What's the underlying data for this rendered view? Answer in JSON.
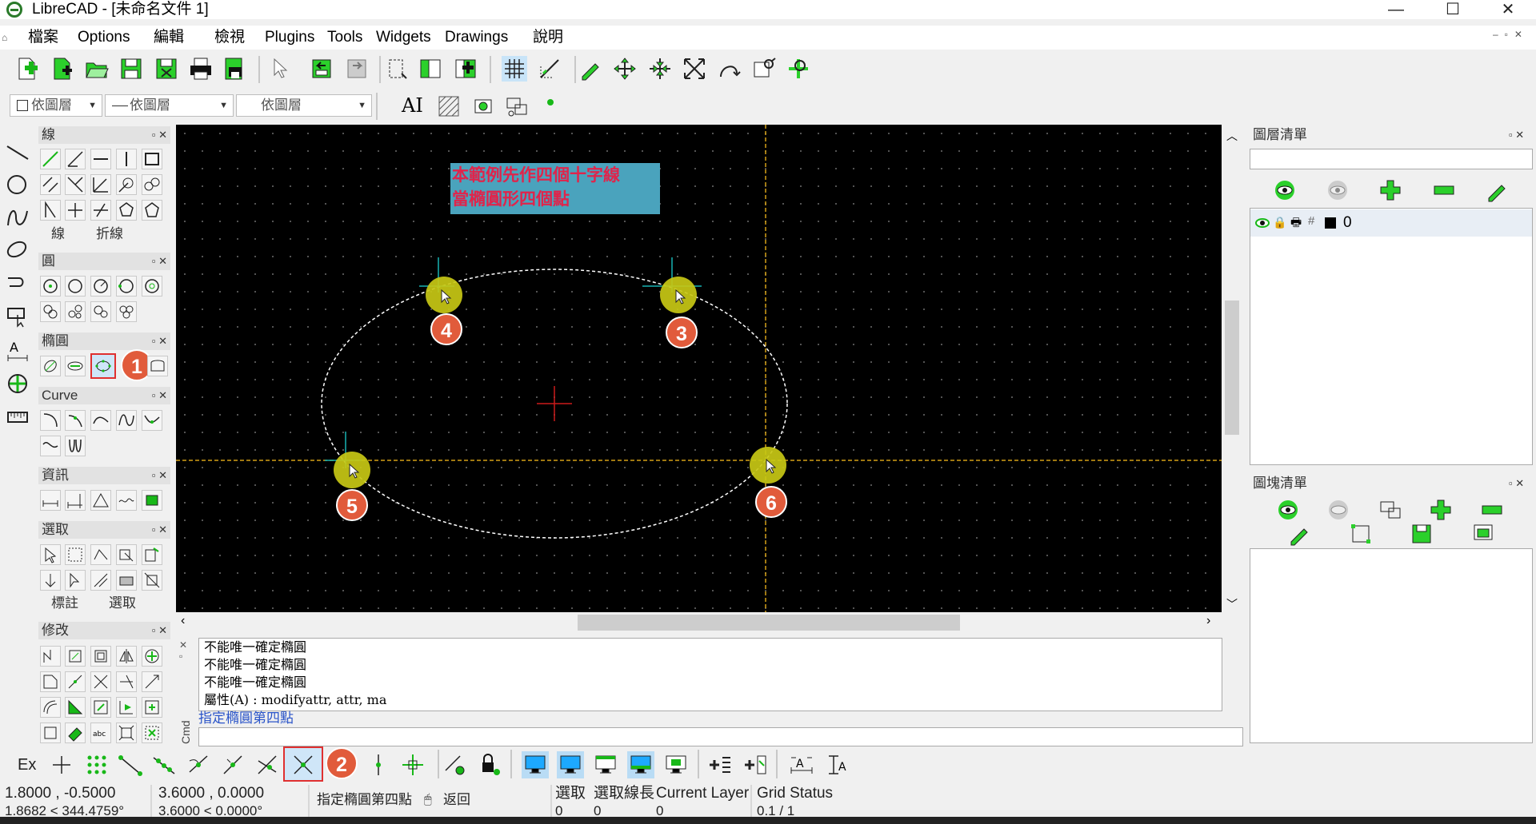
{
  "window": {
    "title": "LibreCAD - [未命名文件 1]",
    "minimize": "—",
    "maximize": "☐",
    "close": "✕"
  },
  "menu": [
    "檔案",
    "Options",
    "編輯",
    "檢視",
    "Plugins",
    "Tools",
    "Widgets",
    "Drawings",
    "說明"
  ],
  "pen_toolbar": {
    "color_combo": "依圖層",
    "linetype_combo": "依圖層",
    "linewidth_combo": "依圖層",
    "text_tool": "AI"
  },
  "left_dock": {
    "line_panel": {
      "title": "線",
      "tabs": [
        "線",
        "折線"
      ]
    },
    "circle_panel": {
      "title": "圓"
    },
    "ellipse_panel": {
      "title": "橢圓"
    },
    "curve_panel": {
      "title": "Curve"
    },
    "info_panel": {
      "title": "資訊"
    },
    "select_panel": {
      "title": "選取",
      "tabs": [
        "標註",
        "選取"
      ]
    },
    "modify_panel": {
      "title": "修改"
    }
  },
  "canvas": {
    "note_line1": "本範例先作四個十字線",
    "note_line2": "當橢圓形四個點",
    "badges": [
      "4",
      "3",
      "5",
      "6"
    ]
  },
  "step_badges": {
    "ellipse_tool": "1",
    "snap_intersection": "2"
  },
  "layer_list": {
    "title": "圖層清單",
    "filter_placeholder": "",
    "layers": [
      {
        "name": "0",
        "color": "#000000"
      }
    ]
  },
  "block_list": {
    "title": "圖塊清單"
  },
  "command": {
    "history": [
      "不能唯一確定橢圓",
      "不能唯一確定橢圓",
      "不能唯一確定橢圓",
      "屬性(A) : modifyattr, attr, ma"
    ],
    "prompt": "指定橢圓第四點",
    "side_label": "Cmd"
  },
  "status": {
    "snap_ex_label": "Ex",
    "abs_coord": "1.8000 , -0.5000",
    "abs_polar": "1.8682 < 344.4759°",
    "rel_coord": "3.6000 , 0.0000",
    "rel_polar": "3.6000 < 0.0000°",
    "action_prompt": "指定橢圓第四點",
    "back_label": "返回",
    "selected_label": "選取",
    "selected_value": "0",
    "sel_length_label": "選取線長",
    "sel_length_value": "0",
    "current_layer_label": "Current Layer",
    "current_layer_value": "0",
    "grid_status_label": "Grid Status",
    "grid_status_value": "0.1 / 1"
  },
  "colors": {
    "accent_badge": "#e15b3b",
    "marker": "#c8c815",
    "note_bg": "#4aa3bd",
    "note_text": "#e0244b",
    "crosshair": "#d4a017"
  }
}
